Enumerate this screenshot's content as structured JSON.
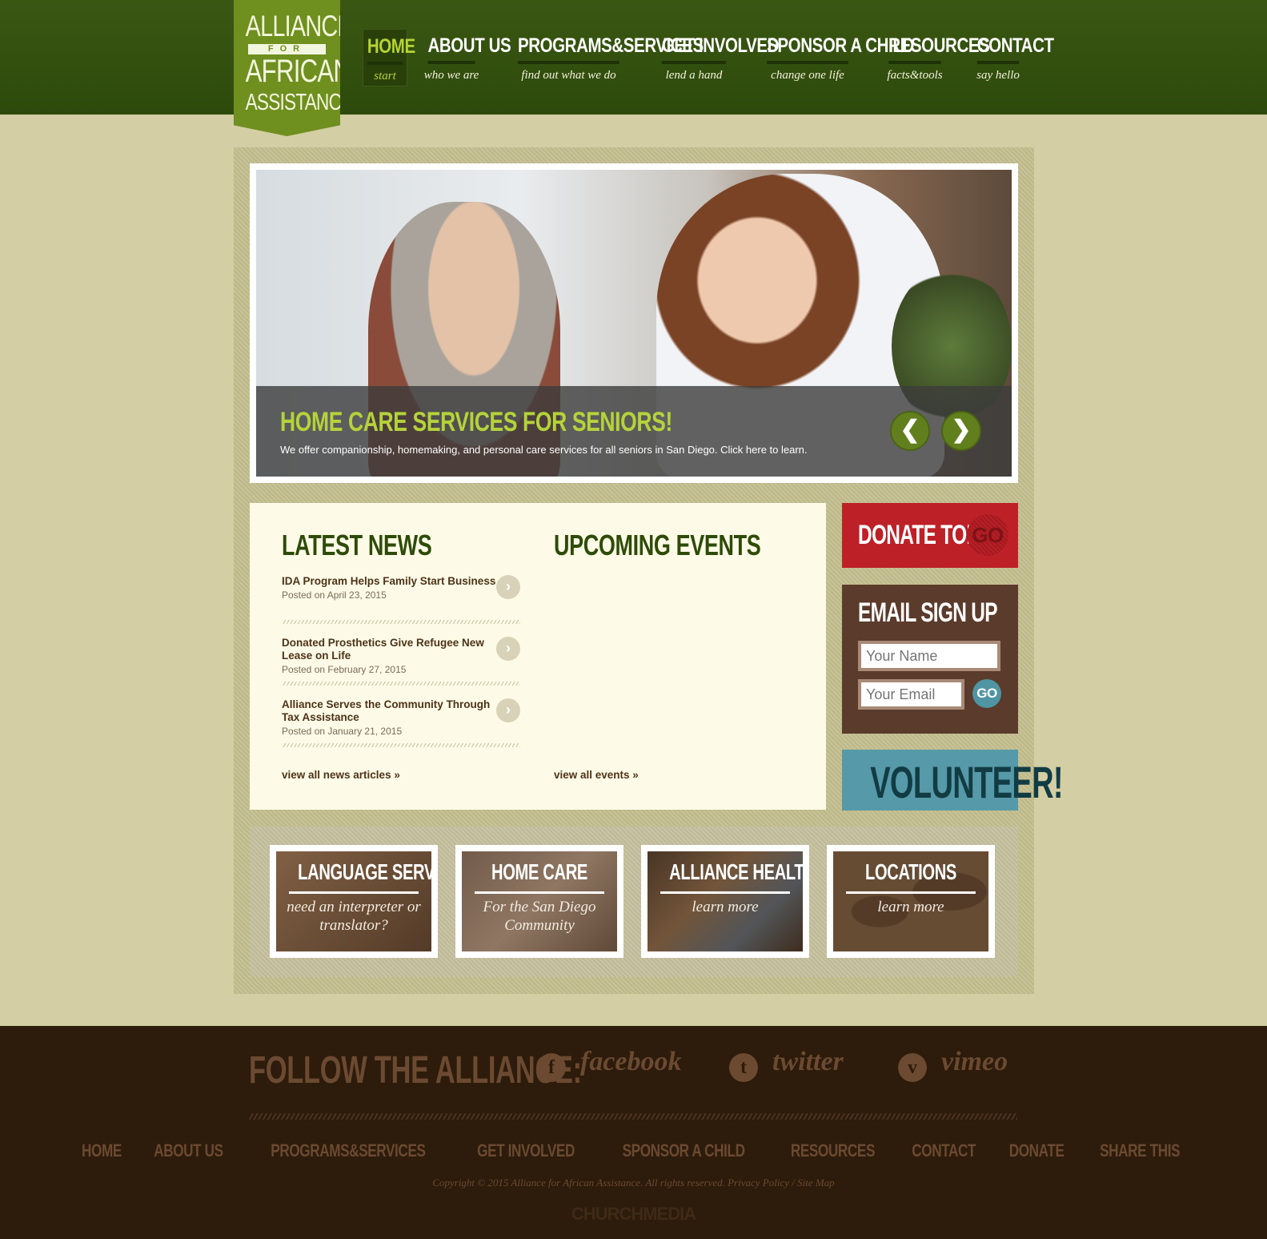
{
  "logo": {
    "line1": "ALLIANCE",
    "line2": "FOR",
    "line3": "AFRICAN",
    "line4": "ASSISTANCE"
  },
  "nav": [
    {
      "label": "HOME",
      "sub": "start"
    },
    {
      "label": "ABOUT US",
      "sub": "who we are"
    },
    {
      "label": "PROGRAMS&SERVICES",
      "sub": "find out what we do"
    },
    {
      "label": "GET INVOLVED",
      "sub": "lend a hand"
    },
    {
      "label": "SPONSOR A CHILD",
      "sub": "change one life"
    },
    {
      "label": "RESOURCES",
      "sub": "facts&tools"
    },
    {
      "label": "CONTACT",
      "sub": "say hello"
    }
  ],
  "slider": {
    "title": "HOME CARE SERVICES FOR SENIORS!",
    "desc": "We offer companionship, homemaking, and personal care services for all seniors in San Diego. Click here to learn.",
    "prev": "❮",
    "next": "❯"
  },
  "news": {
    "heading": "LATEST NEWS",
    "items": [
      {
        "title": "IDA Program Helps Family Start Business",
        "date": "Posted on April 23, 2015"
      },
      {
        "title": "Donated Prosthetics Give Refugee New Lease on Life",
        "date": "Posted on February 27, 2015"
      },
      {
        "title": "Alliance Serves the Community Through Tax Assistance",
        "date": "Posted on January 21, 2015"
      }
    ],
    "more": "view all news articles »"
  },
  "events": {
    "heading": "UPCOMING EVENTS",
    "more": "view all events »"
  },
  "donate": {
    "label": "DONATE TODAY",
    "go": "GO"
  },
  "signup": {
    "heading": "EMAIL SIGN UP",
    "name_placeholder": "Your Name",
    "email_placeholder": "Your Email",
    "go": "GO"
  },
  "volunteer": {
    "label": "VOLUNTEER!"
  },
  "tiles": [
    {
      "title": "LANGUAGE SERVICES",
      "sub": "need an interpreter or translator?"
    },
    {
      "title": "HOME CARE",
      "sub": "For the San Diego Community"
    },
    {
      "title": "ALLIANCE HEALTH CLINIC",
      "sub": "learn more"
    },
    {
      "title": "LOCATIONS",
      "sub": "learn more"
    }
  ],
  "footer": {
    "follow": "FOLLOW THE ALLIANCE:",
    "social": [
      {
        "icon": "f",
        "name": "facebook",
        "icon_name": "facebook-icon"
      },
      {
        "icon": "t",
        "name": "twitter",
        "icon_name": "twitter-icon"
      },
      {
        "icon": "v",
        "name": "vimeo",
        "icon_name": "vimeo-icon"
      }
    ],
    "nav": [
      "HOME",
      "ABOUT US",
      "PROGRAMS&SERVICES",
      "GET INVOLVED",
      "SPONSOR A CHILD",
      "RESOURCES",
      "CONTACT",
      "DONATE",
      "SHARE THIS"
    ],
    "copyright": "Copyright © 2015 Alliance for African Assistance. All rights reserved.  Privacy Policy /  Site Map",
    "credit": "CHURCHMEDIA"
  },
  "colors": {
    "header_green": "#2d4a0c",
    "accent_green": "#b6d334",
    "donate_red": "#bd2127",
    "signup_brown": "#5b3b2b",
    "volunteer_teal": "#5699a8",
    "footer_brown": "#2d1b0b"
  }
}
